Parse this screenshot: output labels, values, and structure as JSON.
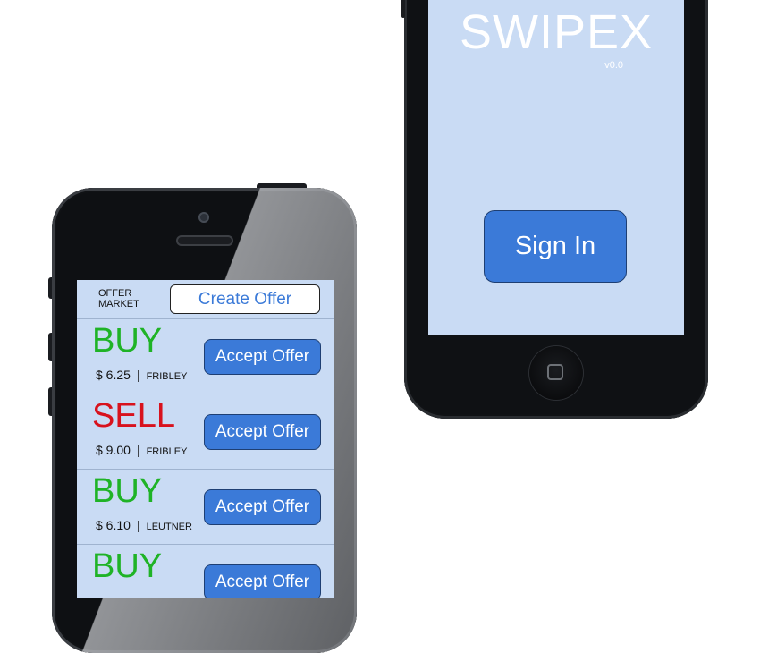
{
  "signin_screen": {
    "app_name": "SWIPEX",
    "version": "v0.0",
    "signin_label": "Sign In"
  },
  "market_screen": {
    "title": "OFFER MARKET",
    "create_offer_label": "Create Offer",
    "offers": [
      {
        "type": "BUY",
        "price": "$ 6.25",
        "location": "FRIBLEY",
        "accept_label": "Accept Offer"
      },
      {
        "type": "SELL",
        "price": "$ 9.00",
        "location": "FRIBLEY",
        "accept_label": "Accept Offer"
      },
      {
        "type": "BUY",
        "price": "$ 6.10",
        "location": "LEUTNER",
        "accept_label": "Accept Offer"
      },
      {
        "type": "BUY",
        "price": "",
        "location": "",
        "accept_label": "Accept Offer"
      }
    ]
  },
  "colors": {
    "screen_bg": "#c9dbf4",
    "accent_blue": "#3b7ad8",
    "buy_green": "#1fb326",
    "sell_red": "#d8121d",
    "phone_body": "#0f1114"
  }
}
